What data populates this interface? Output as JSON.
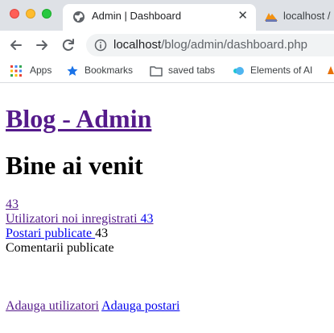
{
  "browser": {
    "active_tab": {
      "title": "Admin | Dashboard",
      "close_glyph": "✕"
    },
    "inactive_tab": {
      "title": "localhost /"
    },
    "address_bar": {
      "host": "localhost",
      "path": "/blog/admin/dashboard.php"
    },
    "bookmarks": [
      {
        "label": "Apps",
        "icon": "apps-grid-icon"
      },
      {
        "label": "Bookmarks",
        "icon": "star-icon"
      },
      {
        "label": "saved tabs",
        "icon": "folder-icon"
      },
      {
        "label": "Elements of AI",
        "icon": "elements-of-ai-icon"
      }
    ],
    "colors": {
      "tabbar": "#dee1e6",
      "link_visited": "#551a8b",
      "link_unvisited": "#0000ee"
    }
  },
  "page": {
    "site_title": "Blog - Admin",
    "welcome": "Bine ai venit",
    "stats": {
      "first_count": "43",
      "new_users_label": "Utilizatori noi inregistrati",
      "new_users_count": "43",
      "posts_label": "Postari publicate",
      "posts_count": "43",
      "comments_label": "Comentarii publicate"
    },
    "actions": {
      "add_users": "Adauga utilizatori",
      "add_posts": "Adauga postari"
    }
  }
}
